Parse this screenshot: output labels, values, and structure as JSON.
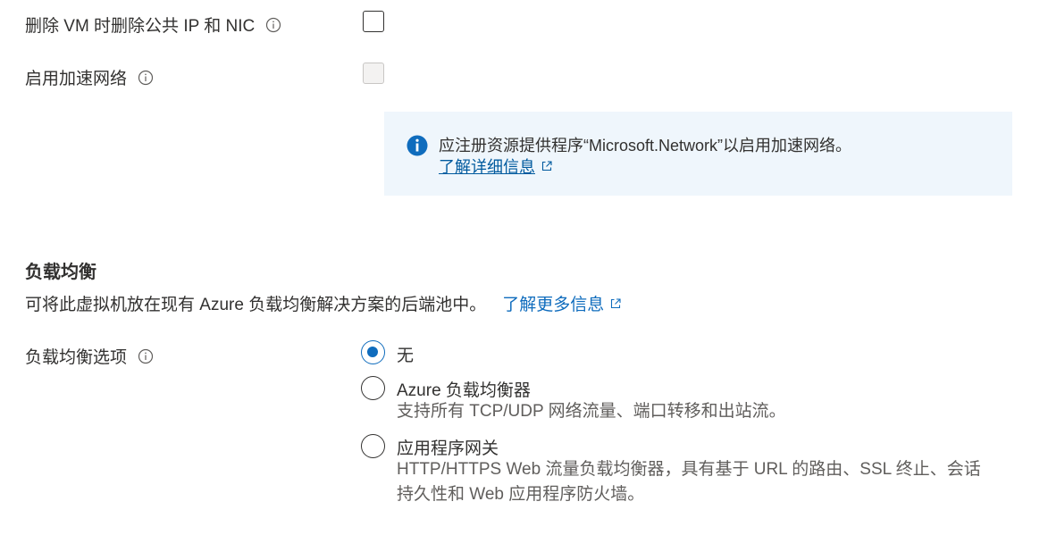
{
  "delete_public_ip": {
    "label": "删除 VM 时删除公共 IP 和 NIC",
    "info_icon": "info-circle-outline",
    "checked": false
  },
  "accelerated_networking": {
    "label": "启用加速网络",
    "info_icon": "info-circle-outline",
    "checked": false,
    "disabled": true
  },
  "info_banner": {
    "icon": "info-circle-filled",
    "message": "应注册资源提供程序“Microsoft.Network”以启用加速网络。",
    "link_label": "了解详细信息",
    "link_icon": "external-link-icon",
    "background": "#eff6fc",
    "icon_color": "#0f6cbd"
  },
  "load_balancing": {
    "title": "负载均衡",
    "description": "可将此虚拟机放在现有 Azure 负载均衡解决方案的后端池中。",
    "learn_more": "了解更多信息",
    "option_label": "负载均衡选项",
    "options": [
      {
        "label": "无",
        "description": "",
        "selected": true
      },
      {
        "label": "Azure 负载均衡器",
        "description": "支持所有 TCP/UDP 网络流量、端口转移和出站流。",
        "selected": false
      },
      {
        "label": "应用程序网关",
        "description_line1": "HTTP/HTTPS Web 流量负载均衡器，具有基于 URL 的路由、SSL 终止、会话",
        "description_line2": "持久性和 Web 应用程序防火墙。",
        "selected": false
      }
    ]
  },
  "colors": {
    "accent": "#0f6cbd",
    "text": "#323130",
    "secondary_text": "#605e5c",
    "link": "#005a9e"
  }
}
